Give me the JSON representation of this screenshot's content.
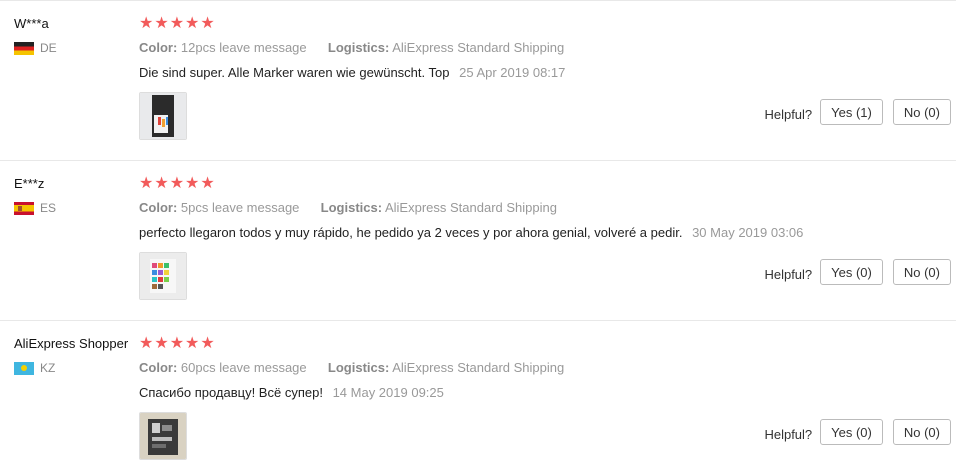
{
  "labels": {
    "color": "Color:",
    "logistics": "Logistics:",
    "helpful": "Helpful?"
  },
  "reviews": [
    {
      "buyer": "W***a",
      "country": "DE",
      "stars": "★★★★★",
      "rating": 5,
      "color_value": "12pcs leave message",
      "logistics_value": "AliExpress Standard Shipping",
      "text": "Die sind super. Alle Marker waren wie gewünscht. Top",
      "date": "25 Apr 2019 08:17",
      "yes": "Yes (1)",
      "no": "No (0)"
    },
    {
      "buyer": "E***z",
      "country": "ES",
      "stars": "★★★★★",
      "rating": 5,
      "color_value": "5pcs leave message",
      "logistics_value": "AliExpress Standard Shipping",
      "text": "perfecto llegaron todos y muy rápido, he pedido ya 2 veces y por ahora genial, volveré a pedir.",
      "date": "30 May 2019 03:06",
      "yes": "Yes (0)",
      "no": "No (0)"
    },
    {
      "buyer": "AliExpress Shopper",
      "country": "KZ",
      "stars": "★★★★★",
      "rating": 5,
      "color_value": "60pcs leave message",
      "logistics_value": "AliExpress Standard Shipping",
      "text": "Спасибо продавцу! Всё супер!",
      "date": "14 May 2019 09:25",
      "yes": "Yes (0)",
      "no": "No (0)"
    }
  ],
  "colors": {
    "star": "#f25b5b",
    "meta": "#999999",
    "border": "#e8e8e8"
  }
}
